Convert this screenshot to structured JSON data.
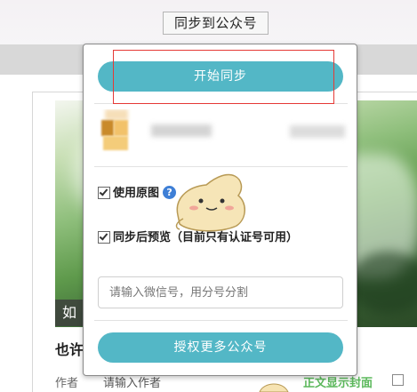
{
  "toolbar": {
    "sync_label": "同步到公众号"
  },
  "editor": {
    "cover_caption": "如",
    "title_fragment": "也许",
    "author_label": "作者",
    "author_placeholder": "请输入作者",
    "show_cover_label": "正文显示封面"
  },
  "popup": {
    "start_button": "开始同步",
    "options": {
      "use_original": "使用原图",
      "help_icon": "?",
      "after_sync": "同步后预览（目前只有认证号可用）"
    },
    "wechat_input": {
      "placeholder": "请输入微信号，用分号分割",
      "value": ""
    },
    "authorize_button": "授权更多公众号"
  },
  "colors": {
    "accent": "#53b7c6",
    "highlight_frame": "#e53935",
    "help_icon": "#3e7fd6",
    "green_text": "#5cb85c"
  },
  "icons": [
    "question-icon",
    "checkbox-checked-icon",
    "mascot-icon"
  ]
}
